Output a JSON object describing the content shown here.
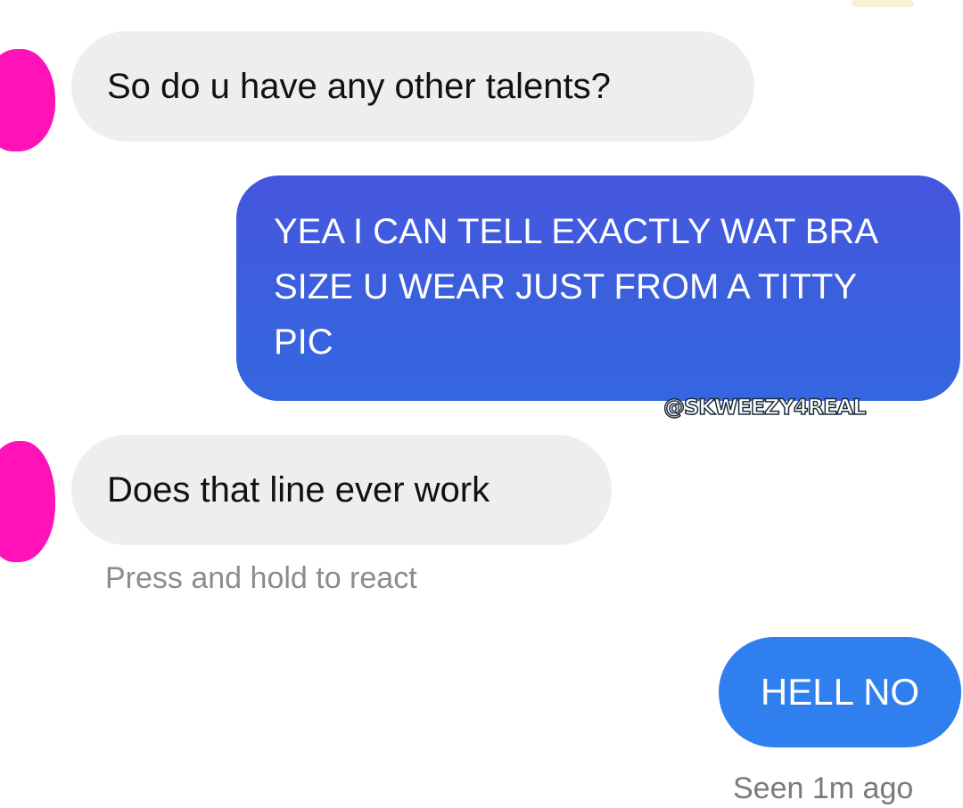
{
  "messages": [
    {
      "sender": "them",
      "text": "So do u have any other talents?"
    },
    {
      "sender": "me",
      "text": "YEA I CAN TELL EXACTLY WAT BRA SIZE U WEAR JUST FROM A TITTY PIC"
    },
    {
      "sender": "them",
      "text": "Does that line ever work"
    },
    {
      "sender": "me",
      "text": "HELL NO"
    }
  ],
  "watermark": "@SKWEEZY4REAL",
  "react_hint": "Press and hold to react",
  "seen_status": "Seen 1m ago",
  "colors": {
    "avatar": "#ff12b8",
    "incoming_bubble": "#eeeeee",
    "outgoing_bubble_large": "#3e5fdd",
    "outgoing_bubble_small": "#2f7fee"
  }
}
